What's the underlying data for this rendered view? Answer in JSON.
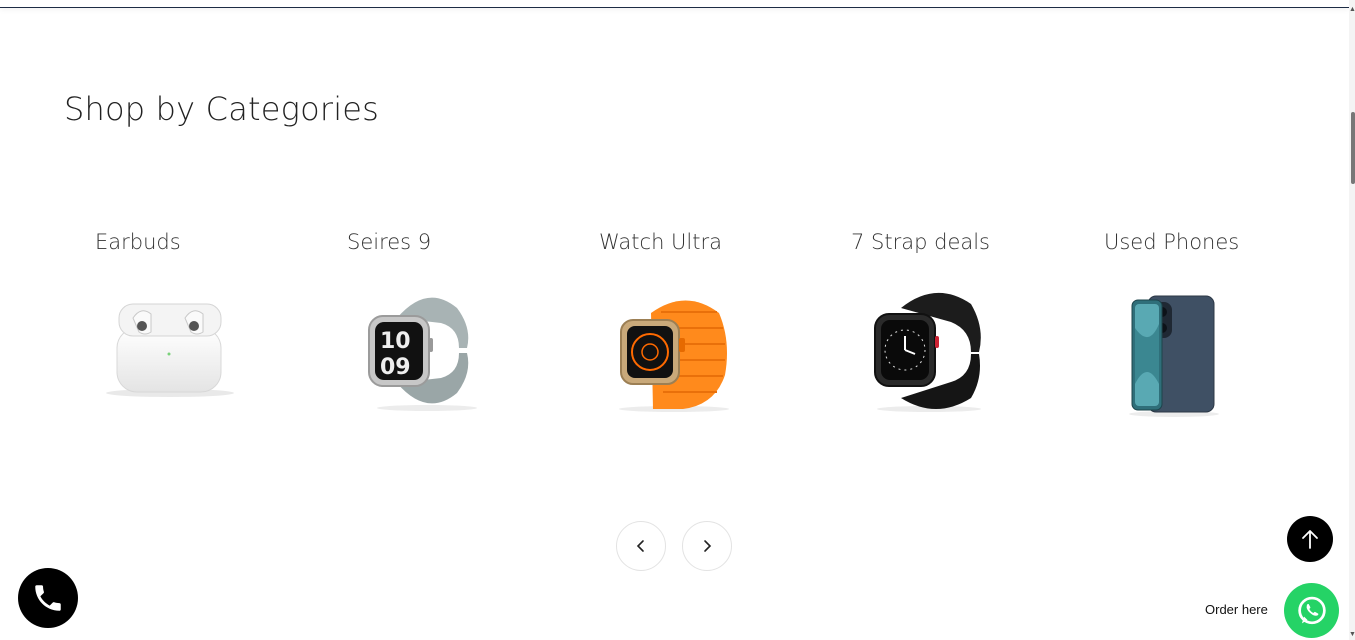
{
  "section": {
    "title": "Shop by Categories"
  },
  "categories": [
    {
      "label": "Earbuds",
      "icon": "earbuds-image"
    },
    {
      "label": "Seires 9",
      "icon": "series9-watch-image"
    },
    {
      "label": "Watch Ultra",
      "icon": "watch-ultra-image"
    },
    {
      "label": "7 Strap deals",
      "icon": "strap-deals-watch-image"
    },
    {
      "label": "Used Phones",
      "icon": "used-phones-image"
    }
  ],
  "carousel": {
    "prev_icon": "chevron-left-icon",
    "next_icon": "chevron-right-icon"
  },
  "floating": {
    "order_label": "Order here",
    "whatsapp_color": "#25d366",
    "call_icon": "phone-icon",
    "top_icon": "arrow-up-icon"
  }
}
